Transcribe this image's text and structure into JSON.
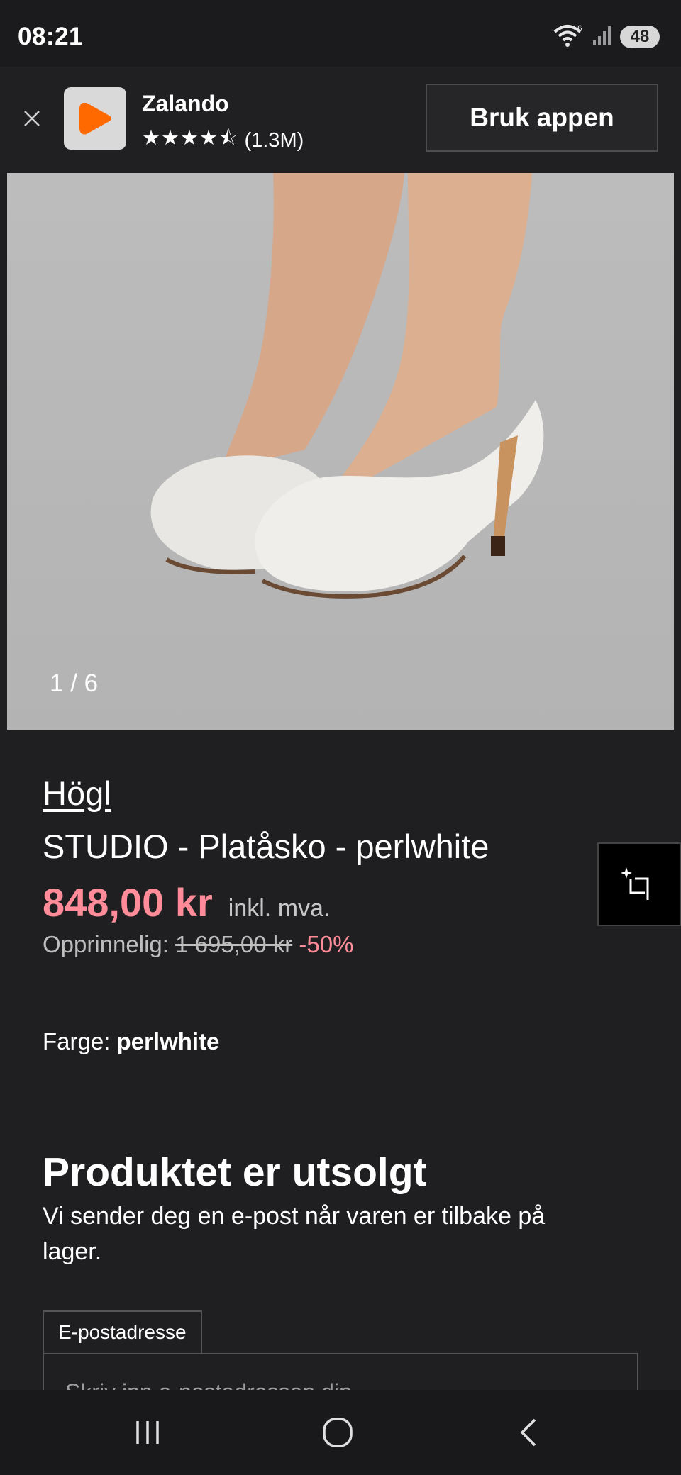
{
  "status_bar": {
    "time": "08:21",
    "battery": "48",
    "wifi_badge": "6"
  },
  "app_banner": {
    "app_name": "Zalando",
    "rating_value": 4.5,
    "rating_stars": "★★★★⯪",
    "rating_count": "(1.3M)",
    "cta_label": "Bruk appen",
    "logo_color": "#ff6900"
  },
  "gallery": {
    "counter": "1 / 6"
  },
  "product": {
    "brand": "Högl",
    "title": "STUDIO - Platåsko - perlwhite",
    "price": "848,00 kr",
    "vat_note": "inkl. mva.",
    "original_label": "Opprinnelig:",
    "original_price": "1 695,00 kr",
    "discount": "-50%",
    "colour_label": "Farge:",
    "colour_value": "perlwhite"
  },
  "soldout": {
    "heading": "Produktet er utsolgt",
    "text": "Vi sender deg en e-post når varen er tilbake på lager.",
    "email_label": "E-postadresse",
    "email_placeholder": "Skriv inn e-postadressen din"
  },
  "colors": {
    "accent_price": "#ff8c98",
    "background": "#1f1f21"
  }
}
